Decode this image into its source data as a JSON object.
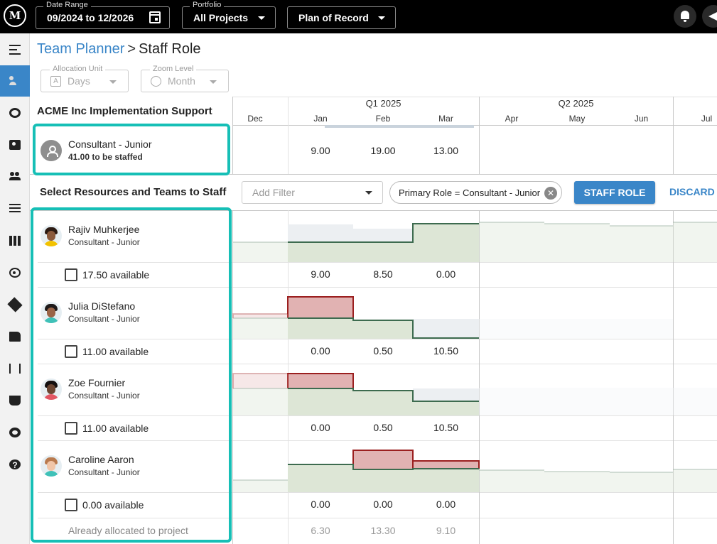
{
  "topbar": {
    "logo_text": "M",
    "date_range": {
      "label": "Date Range",
      "value": "09/2024 to 12/2026"
    },
    "portfolio": {
      "label": "Portfolio",
      "value": "All Projects"
    },
    "plan": {
      "value": "Plan of Record"
    }
  },
  "breadcrumb": {
    "parent": "Team Planner",
    "separator": ">",
    "current": "Staff Role"
  },
  "controls": {
    "allocation_unit": {
      "label": "Allocation Unit",
      "value": "Days",
      "icon": "A"
    },
    "zoom_level": {
      "label": "Zoom Level",
      "value": "Month"
    }
  },
  "timeline": {
    "quarters": [
      {
        "label": "Q1 2025"
      },
      {
        "label": "Q2 2025"
      }
    ],
    "months": [
      "Dec",
      "Jan",
      "Feb",
      "Mar",
      "Apr",
      "May",
      "Jun",
      "Jul"
    ]
  },
  "project": {
    "title": "ACME Inc Implementation Support",
    "role_name": "Consultant - Junior",
    "to_be_staffed": "41.00 to be staffed",
    "demand": [
      "9.00",
      "19.00",
      "13.00"
    ]
  },
  "staffing": {
    "title": "Select Resources and Teams to Staff",
    "filter_placeholder": "Add Filter",
    "chip_label": "Primary Role = Consultant - Junior",
    "chip_remove": "✕",
    "staff_button": "STAFF ROLE",
    "discard_button": "DISCARD"
  },
  "resources": [
    {
      "name": "Rajiv Muhkerjee",
      "role": "Consultant - Junior",
      "available": "17.50 available",
      "values": [
        "9.00",
        "8.50",
        "0.00"
      ],
      "colors": {
        "hair": "#2b1a12",
        "skin": "#8a5a3c",
        "shirt": "#f2c200"
      }
    },
    {
      "name": "Julia DiStefano",
      "role": "Consultant - Junior",
      "available": "11.00 available",
      "values": [
        "0.00",
        "0.50",
        "10.50"
      ],
      "colors": {
        "hair": "#1e1a1a",
        "skin": "#9a6447",
        "shirt": "#3fc1b8"
      }
    },
    {
      "name": "Zoe Fournier",
      "role": "Consultant - Junior",
      "available": "11.00 available",
      "values": [
        "0.00",
        "0.50",
        "10.50"
      ],
      "colors": {
        "hair": "#141010",
        "skin": "#6b4632",
        "shirt": "#e25663"
      }
    },
    {
      "name": "Caroline Aaron",
      "role": "Consultant - Junior",
      "available": "0.00 available",
      "values": [
        "0.00",
        "0.00",
        "0.00"
      ],
      "colors": {
        "hair": "#b97a4e",
        "skin": "#f1c6a8",
        "shirt": "#3fc1b8"
      }
    }
  ],
  "already_allocated": {
    "label": "Already allocated to project",
    "values": [
      "6.30",
      "13.30",
      "9.10"
    ]
  },
  "colors": {
    "accent": "#3a86c8",
    "highlight": "#16bfb6",
    "capacity_fill": "#dde6d6",
    "capacity_line": "#3d6b4f",
    "over_fill": "#e1b2b2",
    "over_line": "#9b1f1f",
    "booked_fill": "#eceff2"
  }
}
